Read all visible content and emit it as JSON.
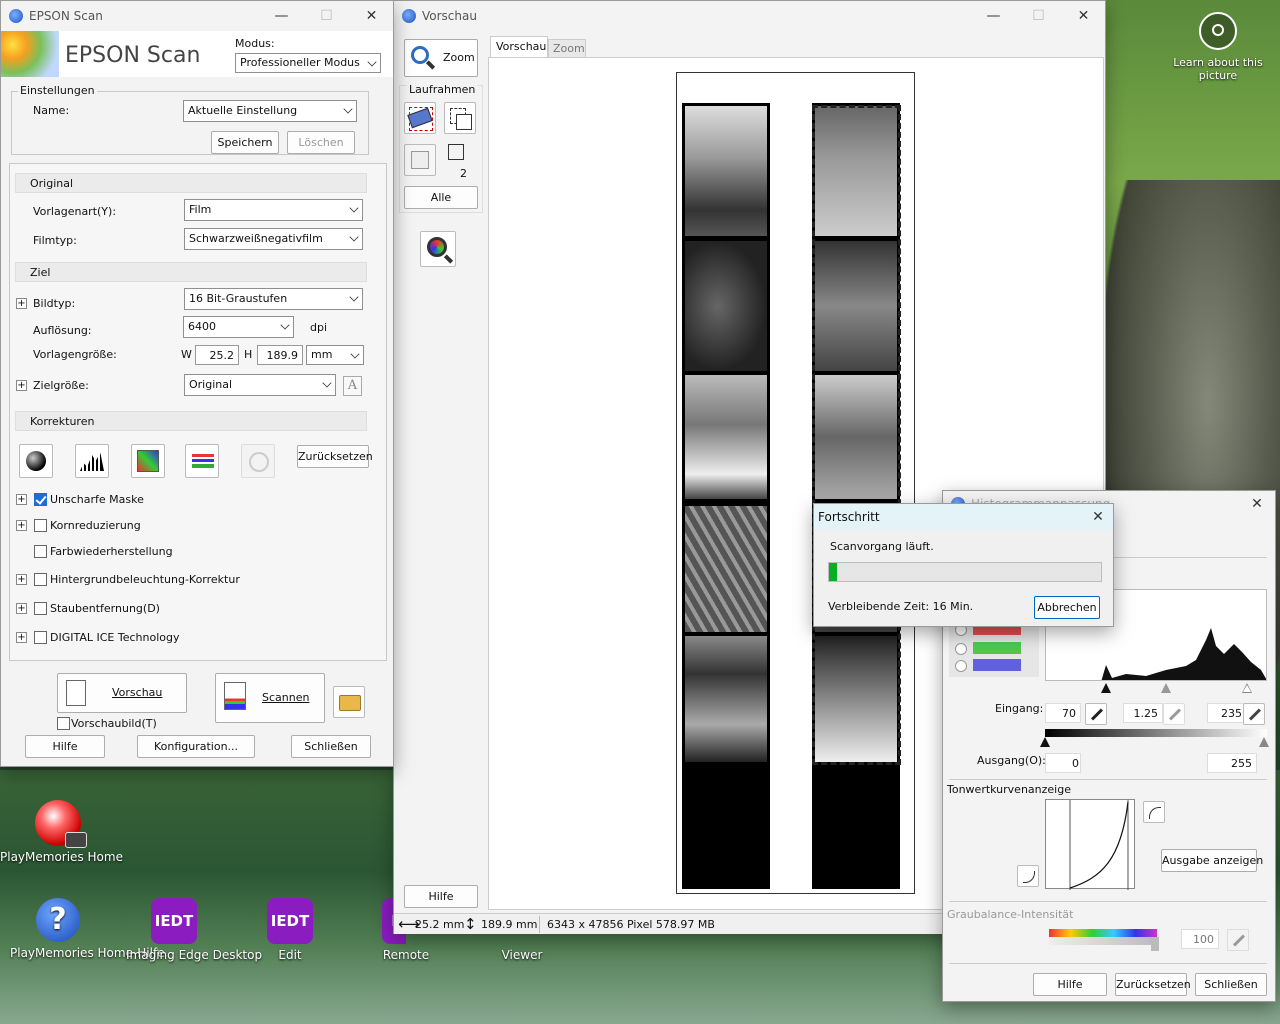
{
  "desktop": {
    "learn": {
      "label": "Learn about this picture"
    },
    "icons": [
      {
        "name": "playmemories-home",
        "label": "PlayMemories Home"
      },
      {
        "name": "playmemories-home-hilfe",
        "label": "PlayMemories Home-Hilfe"
      },
      {
        "name": "imaging-edge-desktop",
        "label": "Imaging Edge Desktop",
        "glyph": "IEDT"
      },
      {
        "name": "edit",
        "label": "Edit",
        "glyph": "IEDT"
      },
      {
        "name": "remote",
        "label": "Remote",
        "glyph": "I"
      },
      {
        "name": "viewer",
        "label": "Viewer"
      }
    ]
  },
  "epson": {
    "title": "EPSON Scan",
    "brand": "EPSON Scan",
    "modus_label": "Modus:",
    "modus_value": "Professioneller Modus",
    "einstellungen": {
      "title": "Einstellungen",
      "name_label": "Name:",
      "name_value": "Aktuelle Einstellung",
      "save": "Speichern",
      "delete": "Löschen"
    },
    "original": {
      "title": "Original",
      "vorlagenart_label": "Vorlagenart(Y):",
      "vorlagenart_value": "Film",
      "filmtyp_label": "Filmtyp:",
      "filmtyp_value": "Schwarzweißnegativfilm"
    },
    "ziel": {
      "title": "Ziel",
      "bildtyp_label": "Bildtyp:",
      "bildtyp_value": "16 Bit-Graustufen",
      "aufloesung_label": "Auflösung:",
      "aufloesung_value": "6400",
      "dpi": "dpi",
      "groesse_label": "Vorlagengröße:",
      "w_label": "W",
      "w_value": "25.2",
      "h_label": "H",
      "h_value": "189.9",
      "unit": "mm",
      "zielgroesse_label": "Zielgröße:",
      "zielgroesse_value": "Original"
    },
    "korrekturen": {
      "title": "Korrekturen",
      "reset": "Zurücksetzen",
      "options": [
        {
          "label": "Unscharfe Maske",
          "checked": true,
          "expand": true
        },
        {
          "label": "Kornreduzierung",
          "checked": false,
          "expand": true
        },
        {
          "label": "Farbwiederherstellung",
          "checked": false,
          "expand": false
        },
        {
          "label": "Hintergrundbeleuchtung-Korrektur",
          "checked": false,
          "expand": true
        },
        {
          "label": "Staubentfernung(D)",
          "checked": false,
          "expand": true
        },
        {
          "label": "DIGITAL ICE Technology",
          "checked": false,
          "expand": true
        }
      ]
    },
    "preview_btn": "Vorschau",
    "scan_btn": "Scannen",
    "thumbnail": "Vorschaubild(T)",
    "help": "Hilfe",
    "config": "Konfiguration...",
    "close": "Schließen"
  },
  "vorschau": {
    "title": "Vorschau",
    "zoom_btn": "Zoom",
    "tabs": [
      "Vorschau",
      "Zoom"
    ],
    "laufrahmen": "Laufrahmen",
    "count": "2",
    "alle": "Alle",
    "help": "Hilfe",
    "status_w": "25.2 mm",
    "status_h": "189.9 mm",
    "status_info": "6343 x 47856 Pixel 578.97 MB"
  },
  "histogram": {
    "title": "Histogrammanpassung",
    "eingang_label": "Eingang:",
    "in_low": "70",
    "in_gamma": "1.25",
    "in_high": "235",
    "ausgang_label": "Ausgang(O):",
    "out_low": "0",
    "out_high": "255",
    "tonkurve_label": "Tonwertkurvenanzeige",
    "ausgabe_btn": "Ausgabe anzeigen",
    "graubalance_label": "Graubalance-Intensität",
    "graubalance_value": "100",
    "help": "Hilfe",
    "reset": "Zurücksetzen",
    "close": "Schließen"
  },
  "progress": {
    "title": "Fortschritt",
    "status": "Scanvorgang läuft.",
    "remaining": "Verbleibende Zeit: 16 Min.",
    "cancel": "Abbrechen",
    "percent": 3
  }
}
